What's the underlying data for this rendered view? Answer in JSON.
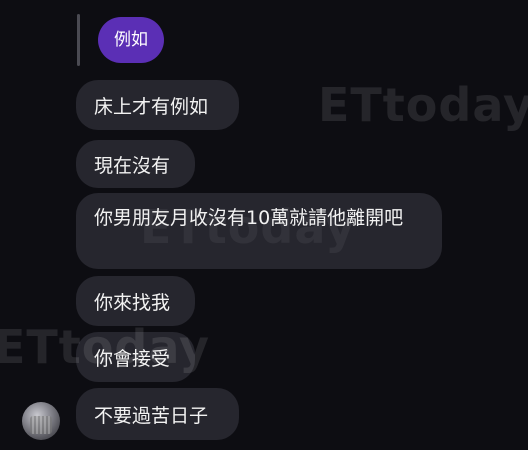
{
  "quoted_reply": "例如",
  "messages": [
    "床上才有例如",
    "現在沒有",
    "你男朋友月收沒有10萬就請他離開吧",
    "你來找我",
    "你會接受",
    "不要過苦日子"
  ],
  "watermark": "ETtoday",
  "colors": {
    "background": "#0d0d12",
    "bubble": "#26262e",
    "reply_bubble": "#5b2fb5"
  }
}
